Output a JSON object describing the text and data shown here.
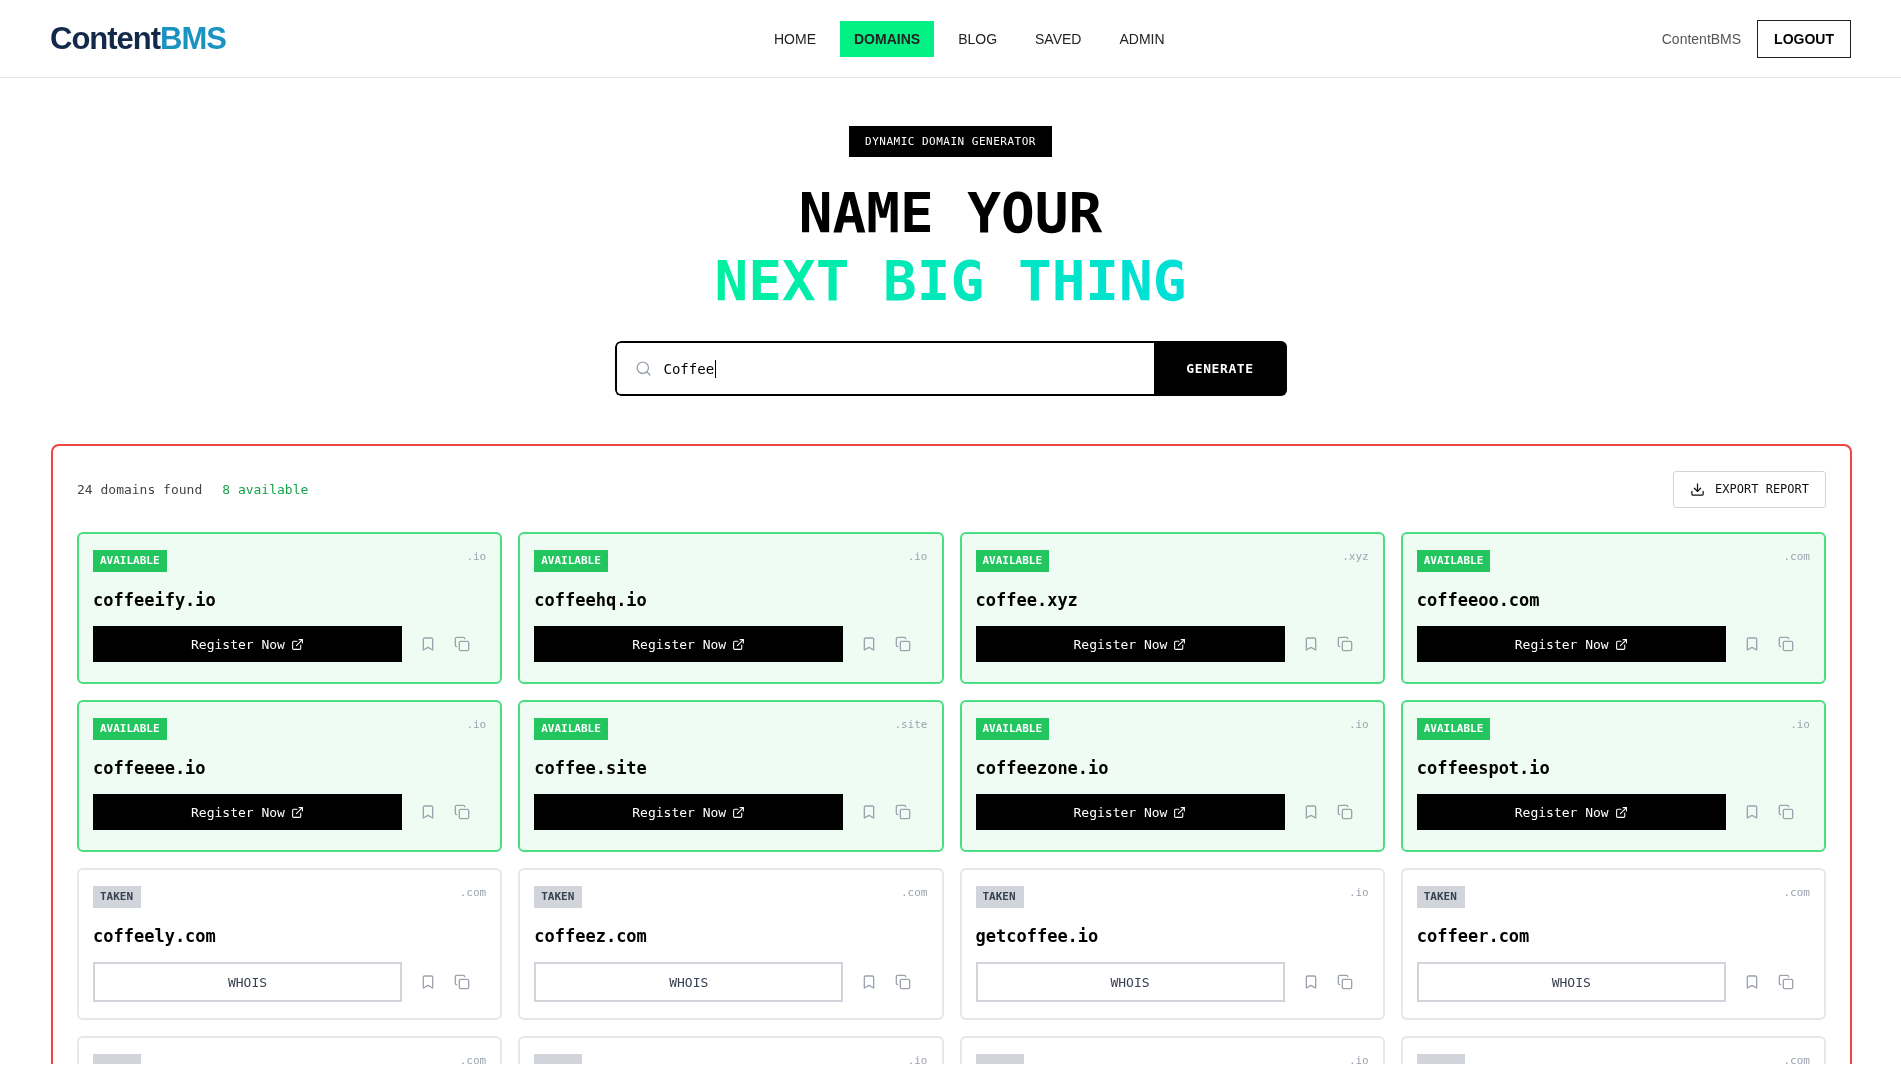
{
  "header": {
    "logo": {
      "part1": "Content",
      "part2": "BMS"
    },
    "nav": [
      {
        "label": "HOME",
        "selected": false
      },
      {
        "label": "DOMAINS",
        "selected": true
      },
      {
        "label": "BLOG",
        "selected": false
      },
      {
        "label": "SAVED",
        "selected": false
      },
      {
        "label": "ADMIN",
        "selected": false
      }
    ],
    "user": "ContentBMS",
    "logout": "LOGOUT"
  },
  "hero": {
    "badge": "DYNAMIC DOMAIN GENERATOR",
    "title_line1": "NAME YOUR",
    "title_line2": "NEXT BIG THING"
  },
  "search": {
    "value": "Coffee",
    "button": "GENERATE"
  },
  "results": {
    "found": "24 domains found",
    "available": "8 available",
    "export": "EXPORT REPORT",
    "cards": [
      {
        "kind": "available",
        "badge": "AVAILABLE",
        "tld": ".io",
        "name": "coffeeify.io",
        "action": "Register Now"
      },
      {
        "kind": "available",
        "badge": "AVAILABLE",
        "tld": ".io",
        "name": "coffeehq.io",
        "action": "Register Now"
      },
      {
        "kind": "available",
        "badge": "AVAILABLE",
        "tld": ".xyz",
        "name": "coffee.xyz",
        "action": "Register Now"
      },
      {
        "kind": "available",
        "badge": "AVAILABLE",
        "tld": ".com",
        "name": "coffeeoo.com",
        "action": "Register Now"
      },
      {
        "kind": "available",
        "badge": "AVAILABLE",
        "tld": ".io",
        "name": "coffeeee.io",
        "action": "Register Now"
      },
      {
        "kind": "available",
        "badge": "AVAILABLE",
        "tld": ".site",
        "name": "coffee.site",
        "action": "Register Now"
      },
      {
        "kind": "available",
        "badge": "AVAILABLE",
        "tld": ".io",
        "name": "coffeezone.io",
        "action": "Register Now"
      },
      {
        "kind": "available",
        "badge": "AVAILABLE",
        "tld": ".io",
        "name": "coffeespot.io",
        "action": "Register Now"
      },
      {
        "kind": "taken",
        "badge": "TAKEN",
        "tld": ".com",
        "name": "coffeely.com",
        "action": "WHOIS"
      },
      {
        "kind": "taken",
        "badge": "TAKEN",
        "tld": ".com",
        "name": "coffeez.com",
        "action": "WHOIS"
      },
      {
        "kind": "taken",
        "badge": "TAKEN",
        "tld": ".io",
        "name": "getcoffee.io",
        "action": "WHOIS"
      },
      {
        "kind": "taken",
        "badge": "TAKEN",
        "tld": ".com",
        "name": "coffeer.com",
        "action": "WHOIS"
      },
      {
        "kind": "taken",
        "tld": ".com"
      },
      {
        "kind": "taken",
        "tld": ".io"
      },
      {
        "kind": "taken",
        "tld": ".io"
      },
      {
        "kind": "taken",
        "tld": ".com"
      }
    ]
  }
}
